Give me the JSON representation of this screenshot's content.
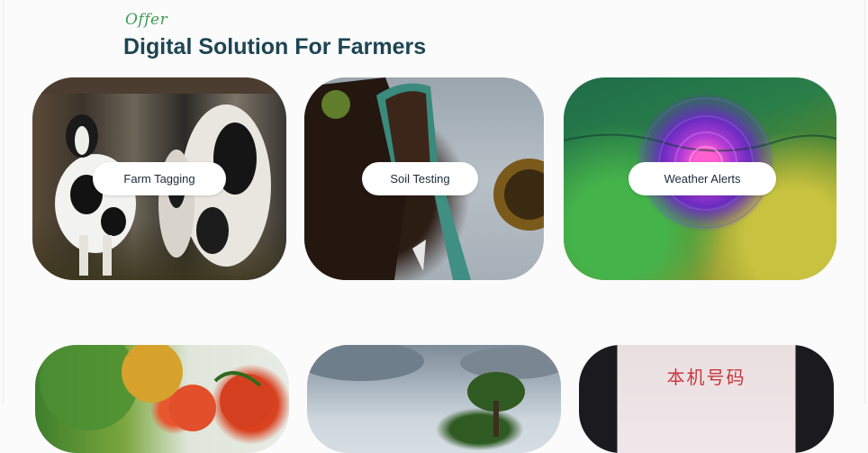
{
  "offer_label": "Offer",
  "section_title": "Digital Solution For Farmers",
  "cards": [
    {
      "label": "Farm Tagging",
      "image": "cows-in-barn"
    },
    {
      "label": "Soil Testing",
      "image": "soil-and-trowel"
    },
    {
      "label": "Weather Alerts",
      "image": "weather-radar-map"
    },
    {
      "label": "",
      "image": "tomatoes-on-vine"
    },
    {
      "label": "",
      "image": "tree-under-cloudy-sky"
    },
    {
      "label": "",
      "image": "chinese-sign",
      "sign_text": "本机号码"
    }
  ],
  "colors": {
    "title": "#1d4552",
    "offer": "#3f9b54",
    "pill_bg": "#ffffff",
    "background": "#fbfbfc"
  }
}
